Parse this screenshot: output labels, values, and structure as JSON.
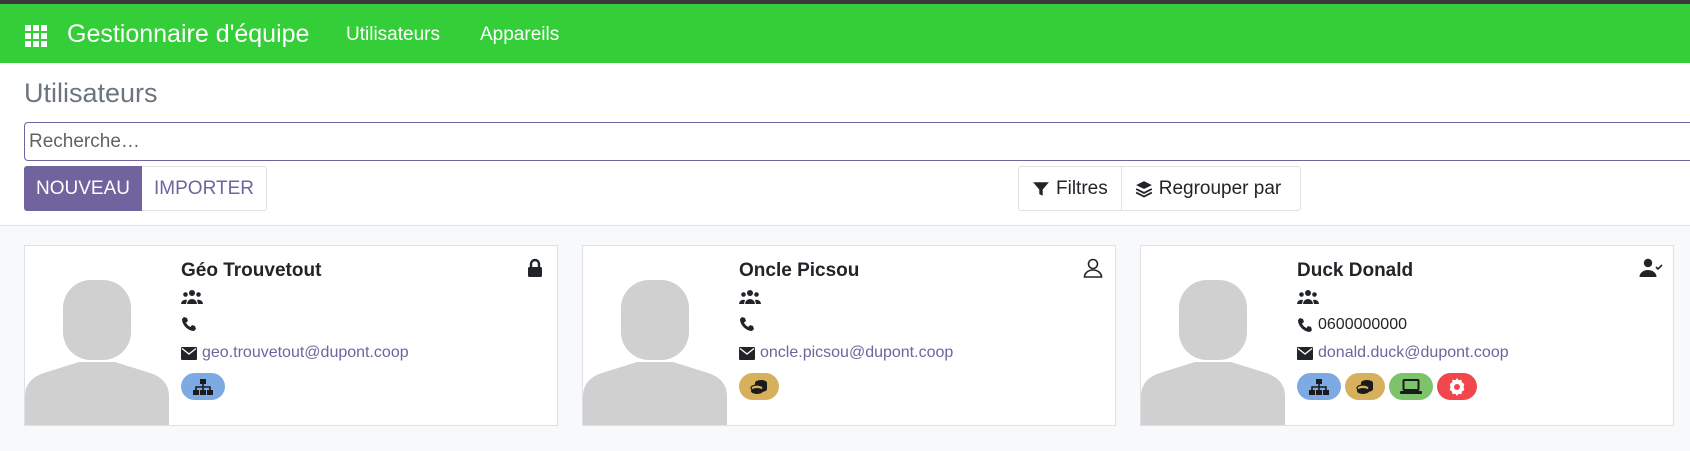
{
  "app": {
    "title": "Gestionnaire d'équipe",
    "apps_icon": "grid-apps-icon"
  },
  "menu": {
    "items": [
      {
        "label": "Utilisateurs"
      },
      {
        "label": "Appareils"
      }
    ]
  },
  "page": {
    "title": "Utilisateurs"
  },
  "search": {
    "placeholder": "Recherche…",
    "value": ""
  },
  "buttons": {
    "new_label": "NOUVEAU",
    "import_label": "IMPORTER",
    "filters_label": "Filtres",
    "group_by_label": "Regrouper par"
  },
  "colors": {
    "navbar": "#34ce38",
    "primary": "#71639e",
    "tag_blue": "#7eaae3",
    "tag_gold": "#d7b05d",
    "tag_green": "#7dc36b",
    "tag_red": "#f1474c"
  },
  "users": [
    {
      "name": "Géo Trouvetout",
      "status_icon": "lock-icon",
      "phone": "",
      "email": "geo.trouvetout@dupont.coop",
      "tags": [
        "network"
      ]
    },
    {
      "name": "Oncle Picsou",
      "status_icon": "user-outline-icon",
      "phone": "",
      "email": "oncle.picsou@dupont.coop",
      "tags": [
        "coins"
      ]
    },
    {
      "name": "Duck Donald",
      "status_icon": "user-check-icon",
      "phone": "0600000000",
      "email": "donald.duck@dupont.coop",
      "tags": [
        "network",
        "coins",
        "laptop",
        "settings"
      ]
    }
  ]
}
